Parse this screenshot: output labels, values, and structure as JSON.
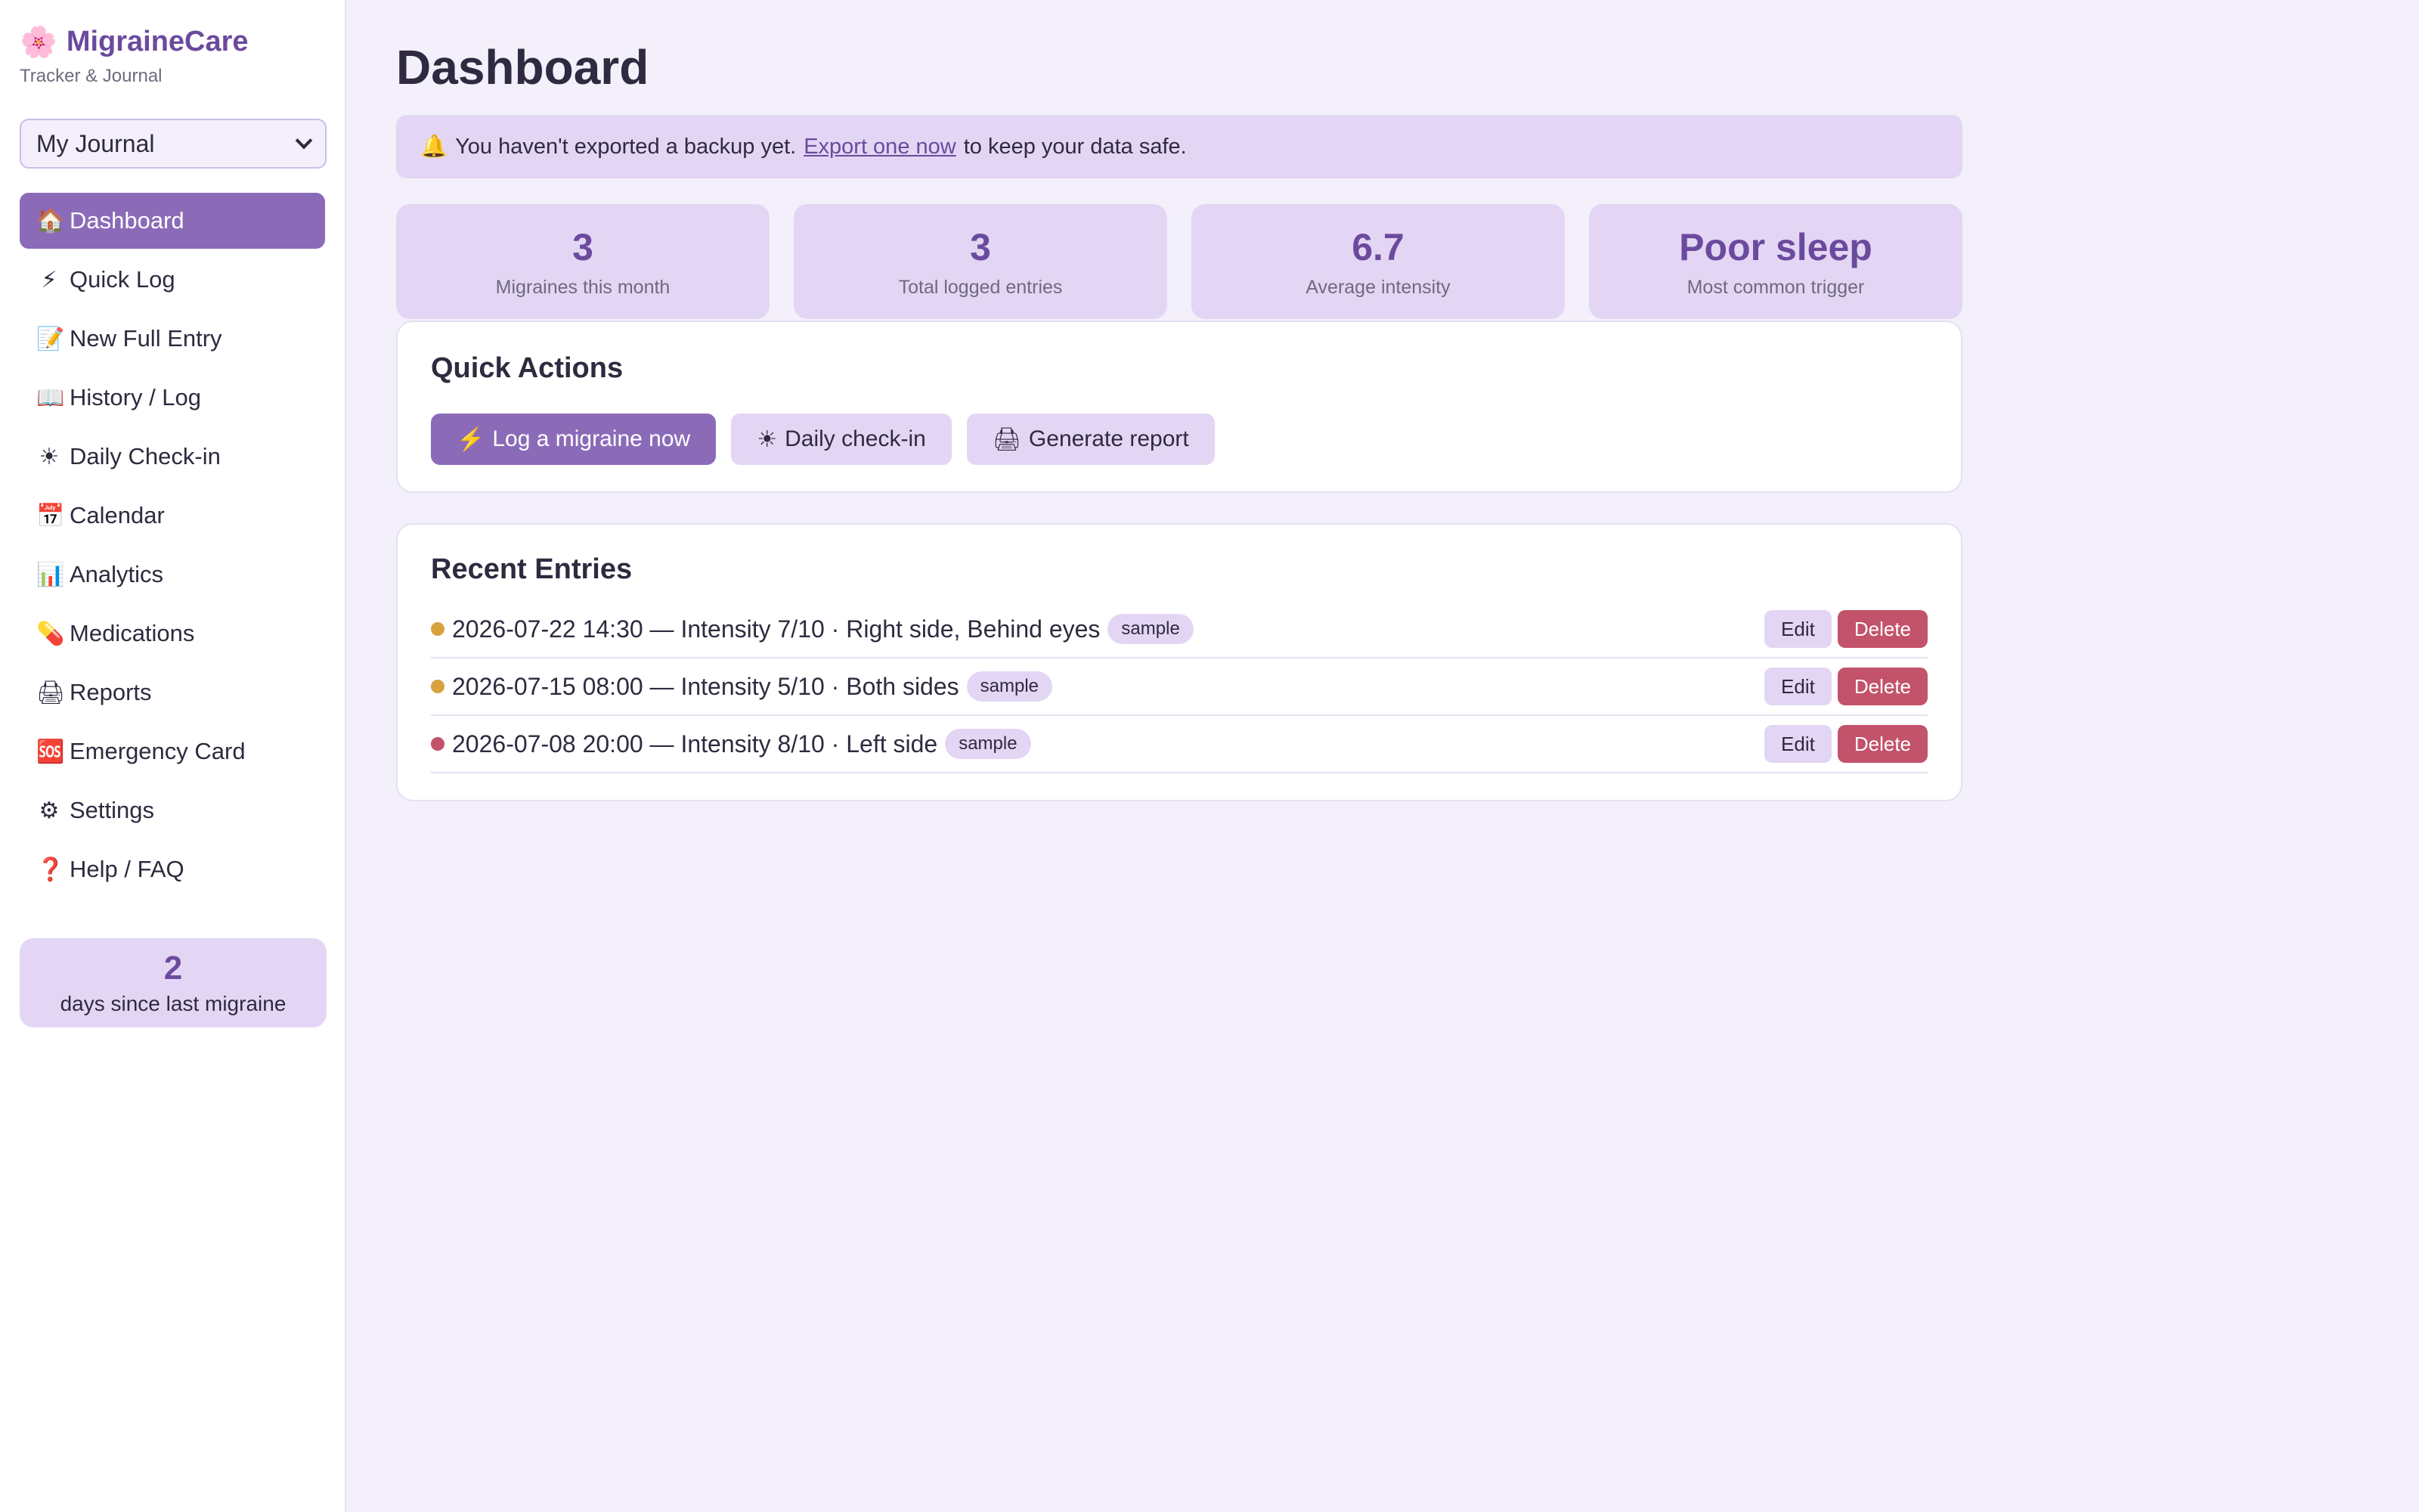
{
  "sidebar": {
    "brand_icon": "🌸",
    "brand_name": "MigraineCare",
    "brand_sub": "Tracker & Journal",
    "journal_select": "My Journal",
    "nav": [
      {
        "icon": "🏠",
        "label": "Dashboard",
        "name": "dashboard",
        "active": true
      },
      {
        "icon": "⚡",
        "label": "Quick Log",
        "name": "quick-log"
      },
      {
        "icon": "📝",
        "label": "New Full Entry",
        "name": "new-full-entry"
      },
      {
        "icon": "📖",
        "label": "History / Log",
        "name": "history-log"
      },
      {
        "icon": "☀",
        "label": "Daily Check-in",
        "name": "daily-checkin"
      },
      {
        "icon": "📅",
        "label": "Calendar",
        "name": "calendar"
      },
      {
        "icon": "📊",
        "label": "Analytics",
        "name": "analytics"
      },
      {
        "icon": "💊",
        "label": "Medications",
        "name": "medications"
      },
      {
        "icon": "🖨",
        "label": "Reports",
        "name": "reports"
      },
      {
        "icon": "🆘",
        "label": "Emergency Card",
        "name": "emergency-card"
      },
      {
        "icon": "⚙",
        "label": "Settings",
        "name": "settings"
      },
      {
        "icon": "❓",
        "label": "Help / FAQ",
        "name": "help-faq"
      }
    ],
    "streak": {
      "value": "2",
      "label": "days since last migraine"
    }
  },
  "main": {
    "title": "Dashboard",
    "notice": {
      "icon": "🔔",
      "before": "You haven't exported a backup yet.",
      "link": "Export one now",
      "after": "to keep your data safe."
    },
    "stats": [
      {
        "value": "3",
        "label": "Migraines this month"
      },
      {
        "value": "3",
        "label": "Total logged entries"
      },
      {
        "value": "6.7",
        "label": "Average intensity"
      },
      {
        "value": "Poor sleep",
        "label": "Most common trigger"
      }
    ],
    "quick_actions": {
      "title": "Quick Actions",
      "buttons": [
        {
          "icon": "⚡",
          "label": "Log a migraine now"
        },
        {
          "icon": "☀",
          "label": "Daily check-in"
        },
        {
          "icon": "🖨",
          "label": "Generate report"
        }
      ]
    },
    "recent": {
      "title": "Recent Entries",
      "edit_label": "Edit",
      "delete_label": "Delete",
      "entries": [
        {
          "text": "2026-07-22 14:30 — Intensity 7/10 · Right side, Behind eyes",
          "tag": "sample",
          "color": "#d9a23f"
        },
        {
          "text": "2026-07-15 08:00 — Intensity 5/10 · Both sides",
          "tag": "sample",
          "color": "#d9a23f"
        },
        {
          "text": "2026-07-08 20:00 — Intensity 8/10 · Left side",
          "tag": "sample",
          "color": "#c2536a"
        }
      ]
    }
  },
  "colors": {
    "accent": "#8b6bb8",
    "accent_dark": "#6b4a9e",
    "soft": "#e3d6f4",
    "danger": "#c2536a"
  }
}
